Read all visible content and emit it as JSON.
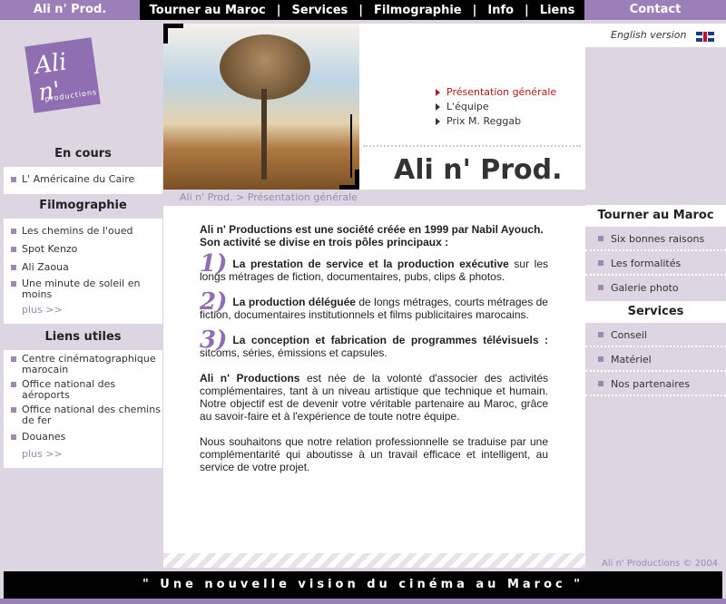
{
  "nav": {
    "brand": "Ali n' Prod.",
    "items": [
      "Tourner au Maroc",
      "Services",
      "Filmographie",
      "Info",
      "Liens"
    ],
    "contact": "Contact"
  },
  "logo": {
    "big": "Ali n'",
    "small": "productions"
  },
  "left": {
    "en_cours": {
      "title": "En cours",
      "items": [
        "L' Américaine du Caire"
      ]
    },
    "filmographie": {
      "title": "Filmographie",
      "items": [
        "Les chemins de l'oued",
        "Spot Kenzo",
        "Ali Zaoua",
        "Une minute de soleil en moins"
      ],
      "more": "plus >>"
    },
    "liens": {
      "title": "Liens utiles",
      "items": [
        "Centre cinématographique marocain",
        "Office national des aéroports",
        "Office national des chemins de fer",
        "Douanes"
      ],
      "more": "plus >>"
    }
  },
  "header": {
    "submenu": [
      "Présentation générale",
      "L'équipe",
      "Prix M. Reggab"
    ],
    "title": "Ali n' Prod.",
    "breadcrumb": "Ali n' Prod. > Présentation générale"
  },
  "content": {
    "intro": "Ali n' Productions est une société créée en 1999 par Nabil Ayouch.",
    "intro2": "Son activité se divise en trois pôles principaux :",
    "poles": [
      {
        "num": "1)",
        "bold": "La prestation de service et la production exécutive",
        "rest": " sur les longs métrages de fiction, documentaires, pubs, clips & photos."
      },
      {
        "num": "2)",
        "bold": "La production déléguée",
        "rest": " de longs métrages, courts métrages de fiction, documentaires institutionnels et films publicitaires marocains."
      },
      {
        "num": "3)",
        "bold": "La conception et fabrication de programmes télévisuels :",
        "rest": " sitcoms, séries, émissions et capsules."
      }
    ],
    "para1_bold": "Ali n' Productions",
    "para1_rest": " est née de la volonté d'associer des activités complémentaires, tant à un niveau artistique que technique et humain. Notre objectif est de devenir votre véritable partenaire au Maroc, grâce au savoir-faire et à l'expérience de toute notre équipe.",
    "para2": "Nous souhaitons que notre relation professionnelle se traduise par une complémentarité qui aboutisse à un travail efficace et intelligent, au service de votre projet."
  },
  "right": {
    "lang": "English version",
    "tourner": {
      "title": "Tourner au Maroc",
      "items": [
        "Six bonnes raisons",
        "Les formalités",
        "Galerie photo"
      ]
    },
    "services": {
      "title": "Services",
      "items": [
        "Conseil",
        "Matériel",
        "Nos partenaires"
      ]
    },
    "copyright": "Ali n' Productions © 2004"
  },
  "footer": "\" Une nouvelle vision du cinéma au Maroc \""
}
